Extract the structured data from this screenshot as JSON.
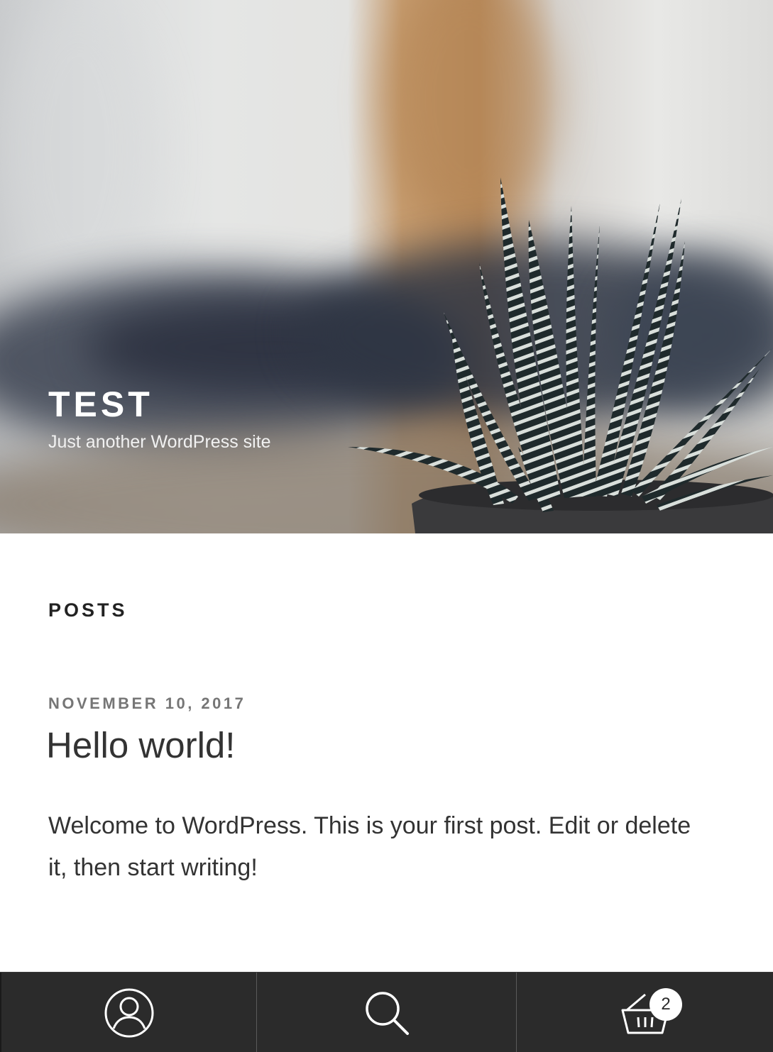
{
  "site": {
    "title": "TEST",
    "description": "Just another WordPress site"
  },
  "content": {
    "section_title": "POSTS",
    "post": {
      "date": "NOVEMBER 10, 2017",
      "title": "Hello world!",
      "excerpt": "Welcome to WordPress. This is your first post. Edit or delete it, then start writing!"
    }
  },
  "bottom_bar": {
    "account_icon": "user-icon",
    "search_icon": "search-icon",
    "cart_icon": "basket-icon",
    "cart_count": "2",
    "background": "#2b2b2b"
  }
}
